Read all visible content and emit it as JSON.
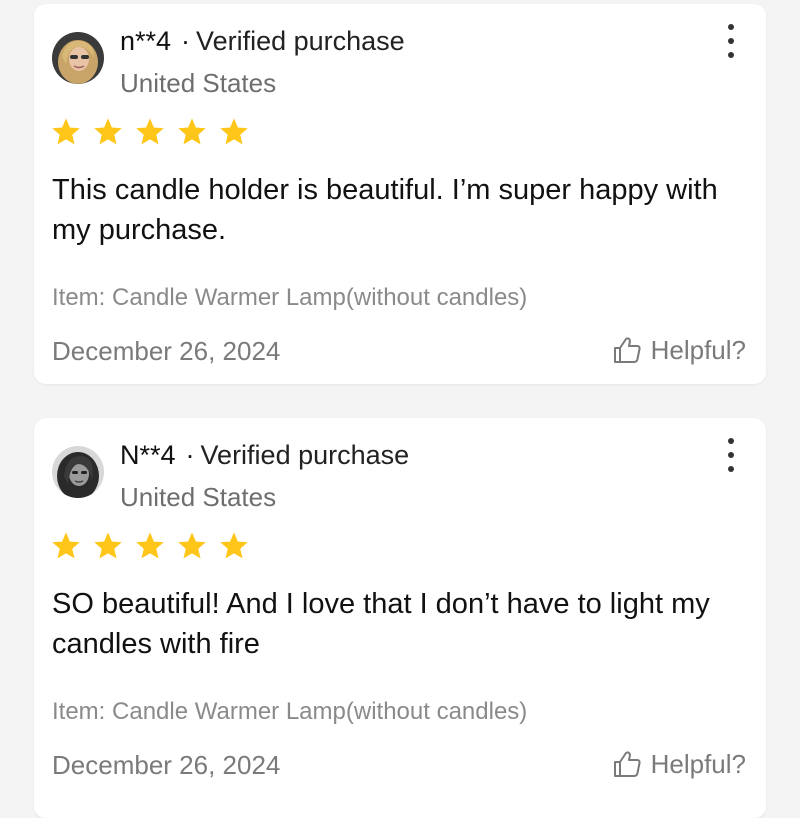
{
  "colors": {
    "star": "#FFC61A",
    "text_primary": "#111111",
    "text_secondary": "#7A7A7A",
    "card_bg": "#FFFFFF",
    "page_bg": "#F4F4F5"
  },
  "reviews": [
    {
      "username": "n**4",
      "separator": "·",
      "badge": "Verified purchase",
      "country": "United States",
      "rating": 5,
      "text": "This candle holder is beautiful. I’m super happy with my purchase.",
      "item": "Item: Candle Warmer Lamp(without candles)",
      "date": "December 26, 2024",
      "helpful_label": "Helpful?",
      "icons": [
        "user-avatar",
        "more-vertical-icon",
        "star-icon",
        "thumbs-up-icon"
      ]
    },
    {
      "username": "N**4",
      "separator": "·",
      "badge": "Verified purchase",
      "country": "United States",
      "rating": 5,
      "text": "SO beautiful! And I love that I don’t have to light my candles with fire",
      "item": "Item: Candle Warmer Lamp(without candles)",
      "date": "December 26, 2024",
      "helpful_label": "Helpful?",
      "icons": [
        "user-avatar",
        "more-vertical-icon",
        "star-icon",
        "thumbs-up-icon"
      ]
    }
  ]
}
